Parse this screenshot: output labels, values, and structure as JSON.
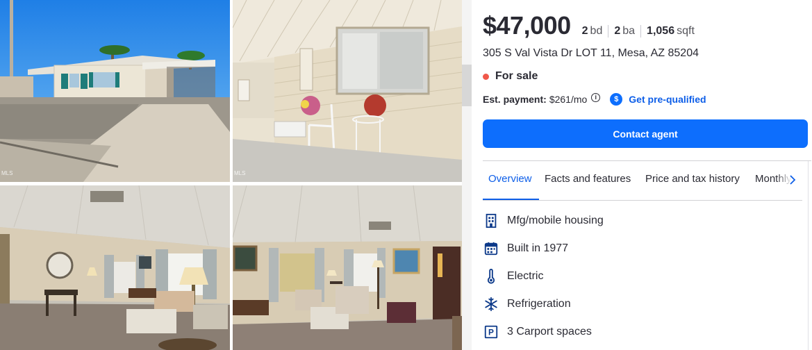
{
  "photos": [
    {
      "name": "exterior-front",
      "mls": "MLS"
    },
    {
      "name": "covered-porch",
      "mls": "MLS"
    },
    {
      "name": "living-room-1",
      "mls": ""
    },
    {
      "name": "living-room-2",
      "mls": ""
    }
  ],
  "listing": {
    "price": "$47,000",
    "beds": "2",
    "beds_unit": "bd",
    "baths": "2",
    "baths_unit": "ba",
    "sqft": "1,056",
    "sqft_unit": "sqft",
    "address": "305 S Val Vista Dr LOT 11, Mesa, AZ 85204",
    "status": "For sale",
    "status_color": "#f0584a"
  },
  "payment": {
    "label": "Est. payment:",
    "amount": "$261/mo",
    "info_icon": "info-icon",
    "prequal_icon": "dollar-badge-icon",
    "prequal_label": "Get pre-qualified"
  },
  "actions": {
    "contact_label": "Contact agent",
    "accent": "#0d6efd"
  },
  "tabs": [
    {
      "label": "Overview",
      "active": true
    },
    {
      "label": "Facts and features",
      "active": false
    },
    {
      "label": "Price and tax history",
      "active": false
    },
    {
      "label": "Monthly payment",
      "active": false
    }
  ],
  "features": [
    {
      "icon": "building-icon",
      "label": "Mfg/mobile housing"
    },
    {
      "icon": "calendar-icon",
      "label": "Built in 1977"
    },
    {
      "icon": "thermometer-icon",
      "label": "Electric"
    },
    {
      "icon": "snowflake-icon",
      "label": "Refrigeration"
    },
    {
      "icon": "parking-icon",
      "label": "3 Carport spaces"
    }
  ]
}
